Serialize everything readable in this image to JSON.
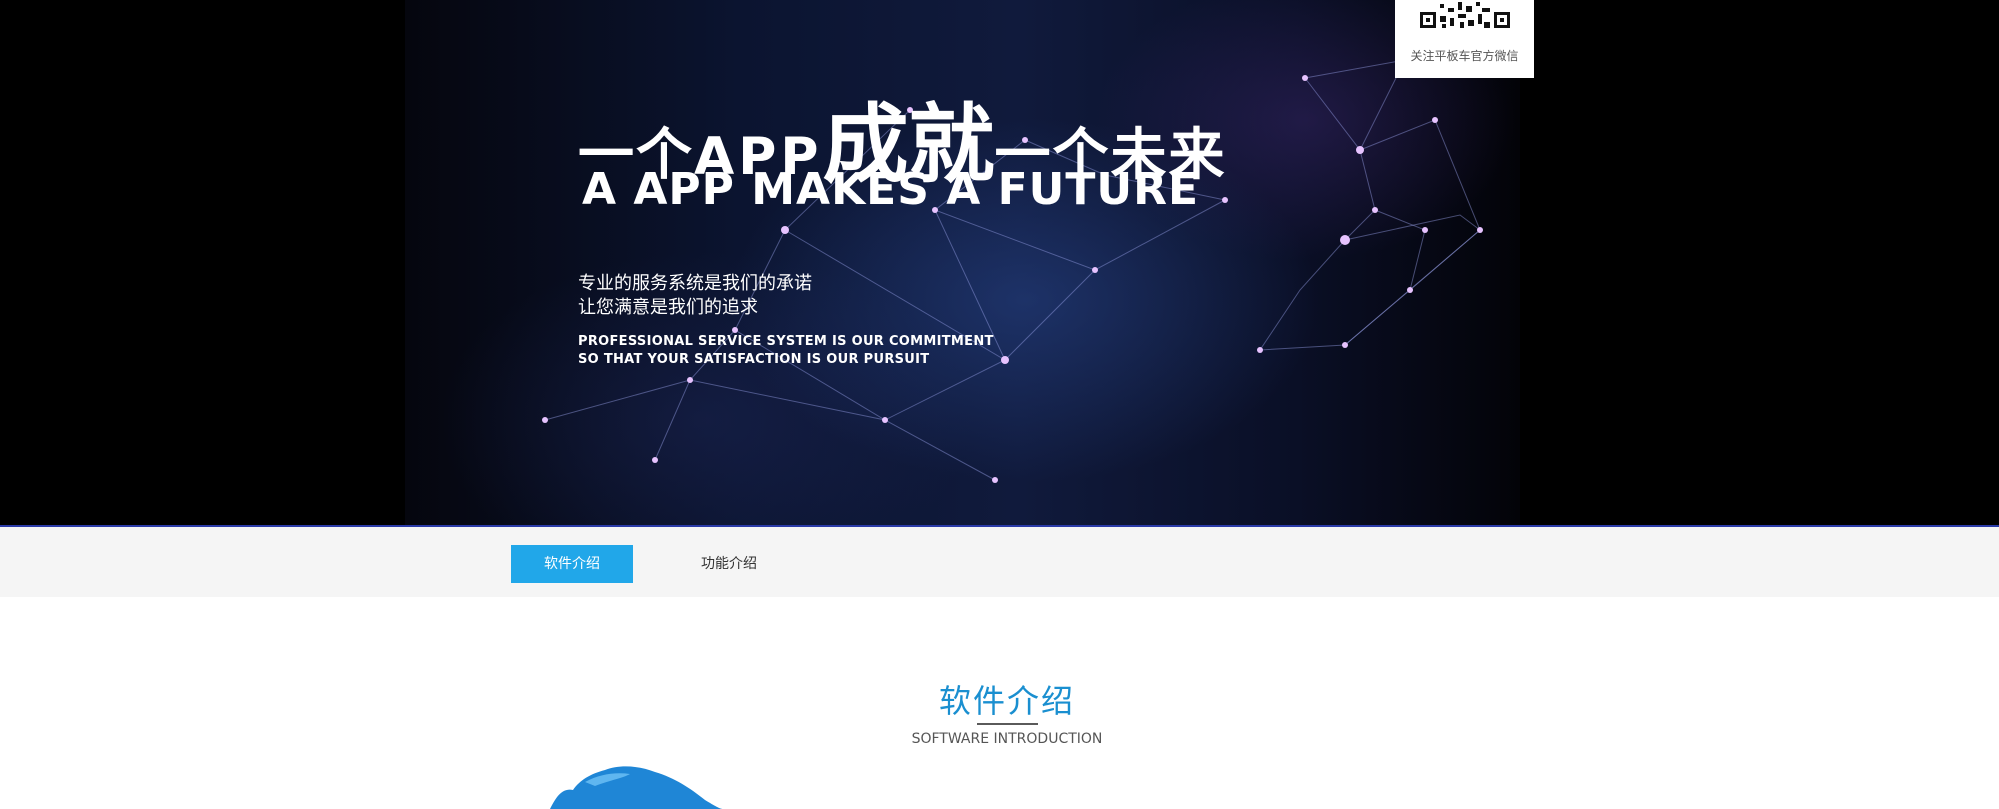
{
  "hero": {
    "headline_part1": "一个",
    "headline_app": "APP",
    "headline_big": "成就",
    "headline_part2": "一个未来",
    "headline_en": "A APP MAKES A FUTURE",
    "sub_cn_line1": "专业的服务系统是我们的承诺",
    "sub_cn_line2": "让您满意是我们的追求",
    "sub_en_line1": "PROFESSIONAL SERVICE SYSTEM IS OUR COMMITMENT",
    "sub_en_line2": "SO THAT YOUR SATISFACTION IS OUR PURSUIT"
  },
  "qr": {
    "caption": "关注平板车官方微信"
  },
  "tabs": [
    {
      "label": "软件介绍",
      "active": true
    },
    {
      "label": "功能介绍",
      "active": false
    }
  ],
  "section": {
    "title": "软件介绍",
    "subtitle": "SOFTWARE INTRODUCTION"
  },
  "colors": {
    "accent": "#21a7e9",
    "section_title": "#1a8fd0",
    "tabbar_bg": "#f5f5f5"
  }
}
